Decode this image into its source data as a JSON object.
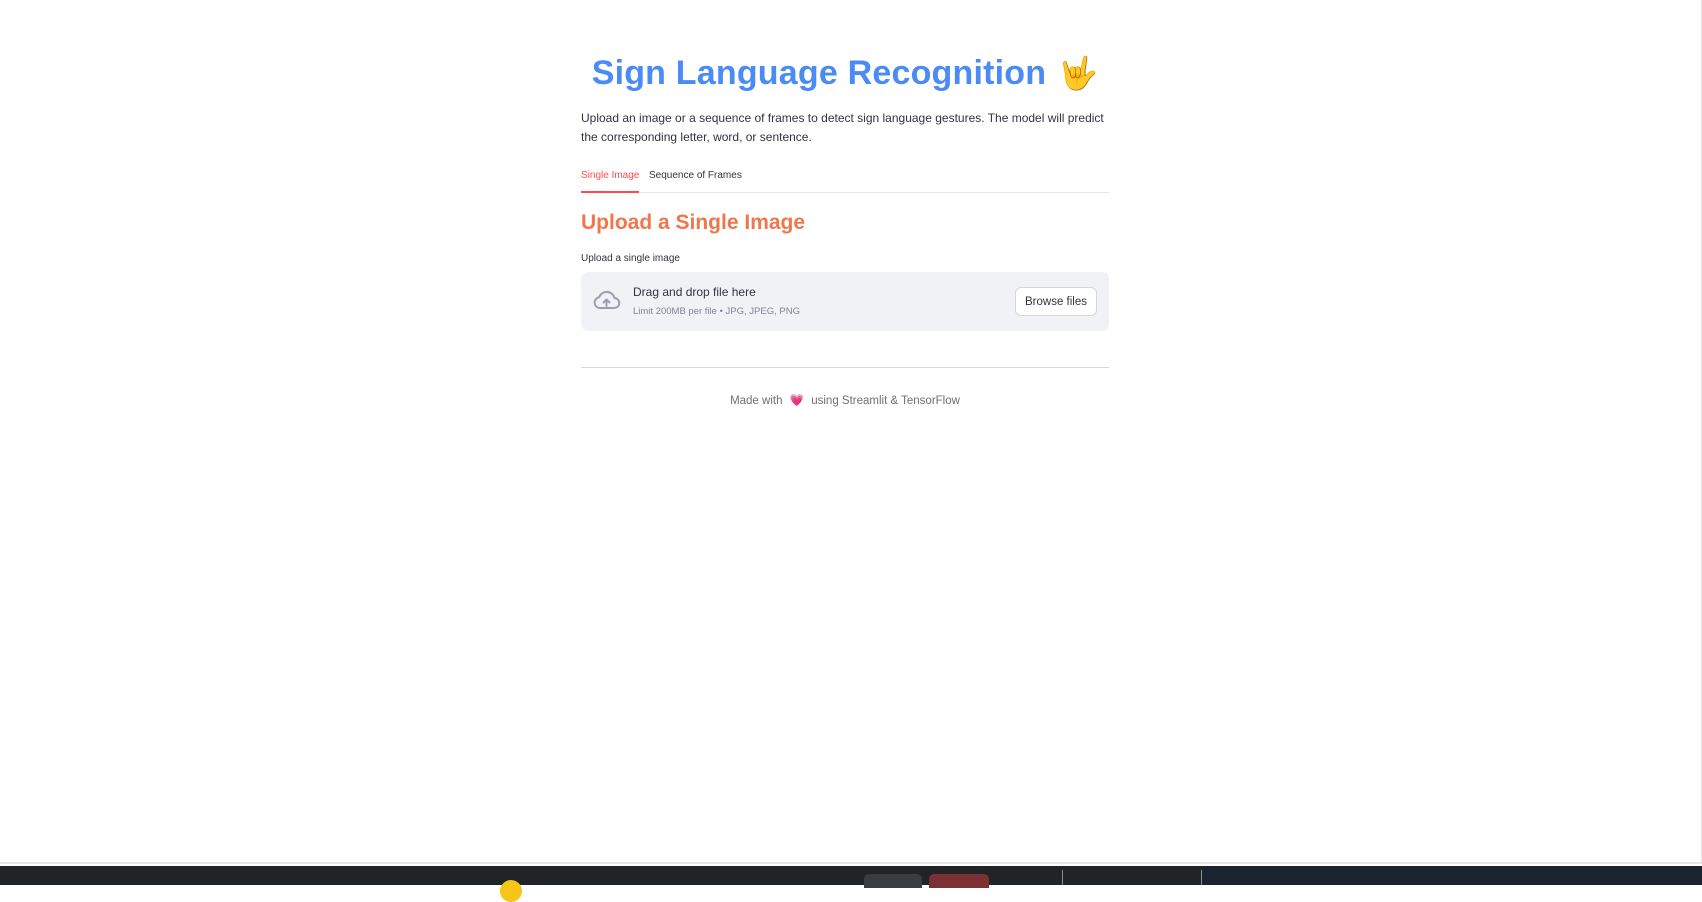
{
  "header": {
    "title": "Sign Language Recognition",
    "title_emoji": "🤟",
    "description": "Upload an image or a sequence of frames to detect sign language gestures. The model will predict the corresponding letter, word, or sentence."
  },
  "tabs": [
    {
      "label": "Single Image",
      "active": true
    },
    {
      "label": "Sequence of Frames",
      "active": false
    }
  ],
  "section": {
    "title": "Upload a Single Image",
    "uploader_label": "Upload a single image"
  },
  "uploader": {
    "drop_text": "Drag and drop file here",
    "limit_text": "Limit 200MB per file • JPG, JPEG, PNG",
    "browse_label": "Browse files",
    "icon": "cloud-upload-icon"
  },
  "footer": {
    "prefix": "Made with",
    "heart": "💗",
    "suffix": "using Streamlit & TensorFlow"
  },
  "colors": {
    "title": "#4b8bf5",
    "section_title": "#f0774c",
    "active_tab": "#ff4b4b",
    "dropzone_bg": "#f0f2f6"
  }
}
